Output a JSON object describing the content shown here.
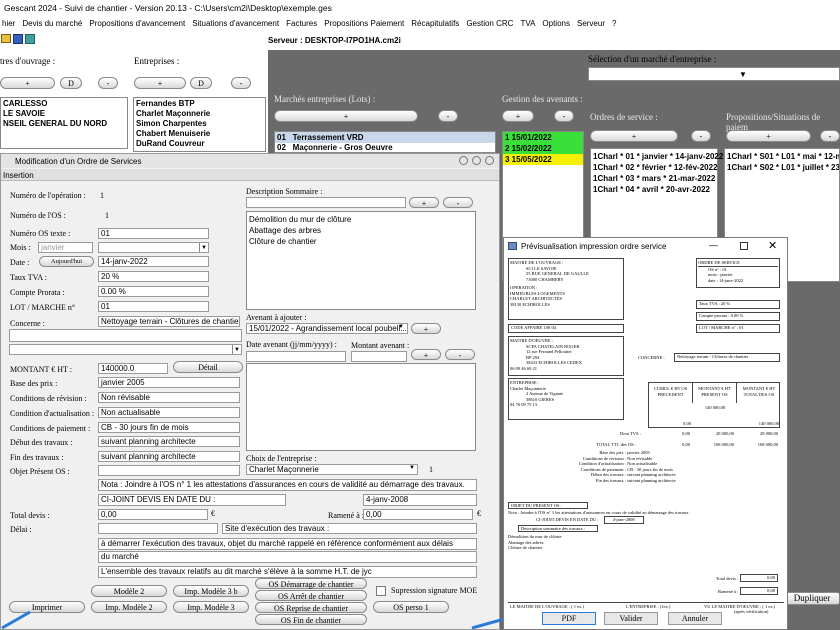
{
  "window": {
    "title": "Gescant 2024 - Suivi de chantier - Version 20.13 - C:\\Users\\cm2i\\Desktop\\exemple.ges"
  },
  "menu": [
    "hier",
    "Devis du marché",
    "Propositions d'avancement",
    "Situations d'avancement",
    "Factures",
    "Propositions Paiement",
    "Récapitulatifs",
    "Gestion CRC",
    "TVA",
    "Options",
    "Serveur",
    "?"
  ],
  "server": "Serveur : DESKTOP-I7PO1HA.cm2i",
  "top": {
    "maitres_label": "tres d'ouvrage :",
    "entreprises_label": "Entreprises :",
    "selection_label": "Sélection d'un marché d'entreprise :",
    "plus": "+",
    "d": "D",
    "minus": "-",
    "maitres": [
      "CARLESSO",
      " LE SAVOIE",
      "NSEIL GENERAL DU NORD"
    ],
    "entreprises": [
      "Fernandes BTP",
      "Charlet Maçonnerie",
      "Simon Charpentes",
      "Chabert Menuiserie",
      "DuRand Couvreur"
    ],
    "marches_label": "Marchés entreprises (Lots) :",
    "marches": [
      {
        "num": "01",
        "label": "Terrassement VRD"
      },
      {
        "num": "02",
        "label": "Maçonnerie - Gros Oeuvre"
      }
    ],
    "avenants_label": "Gestion des avenants :",
    "avenants": [
      {
        "text": "1 15/01/2022",
        "color": "#39e039"
      },
      {
        "text": "2 15/02/2022",
        "color": "#39e039"
      },
      {
        "text": "3 15/05/2022",
        "color": "#f5f000"
      }
    ],
    "os_label": "Ordres de service :",
    "os_items": [
      "1Charl * 01 * janvier * 14-janv-2022",
      "1Charl * 02 * février * 12-fév-2022",
      "1Charl * 03 * mars * 21-mar-2022",
      "1Charl * 04 * avril * 20-avr-2022"
    ],
    "props_label": "Propositions/Situations de paiem",
    "props_items": [
      "1Charl * S01 * L01 * mai * 12-ma",
      "1Charl * S02 * L01 * juillet * 23-ju"
    ],
    "dupliquer": "Dupliquer"
  },
  "modal": {
    "title": "Modification d'un Ordre de Services",
    "tab": "Insertion",
    "num_operation_label": "Numéro de l'opération :",
    "num_operation": "1",
    "num_os_label": "Numéro de l'OS :",
    "num_os": "1",
    "num_os_texte_label": "Numéro OS texte :",
    "num_os_texte": "01",
    "mois_label": "Mois :",
    "mois_placeholder": "janvier",
    "date_label": "Date :",
    "aujourdhui": "Aujourd'hui",
    "date": "14-janv-2022",
    "taux_tva_label": "Taux TVA :",
    "taux_tva": "20 %",
    "compte_prorata_label": "Compte Prorata :",
    "compte_prorata": "0.00 %",
    "lot_label": "LOT / MARCHE n°",
    "lot": "01",
    "concerne_label": "Concerne :",
    "concerne": "Nettoyage terrain - Clôtures de chantier",
    "description_label": "Description Sommaire :",
    "description_lines": [
      "Démolition du mur de clôture",
      "Abattage des arbres",
      "Clôture de chantier"
    ],
    "avenant_label": "Avenant à ajouter :",
    "avenant_value": "15/01/2022 - Agrandissement local poubell...",
    "date_avenant_label": "Date avenant (jj/mm/yyyy) :",
    "montant_avenant_label": "Montant avenant :",
    "montant_ht_label": "MONTANT € HT :",
    "montant_ht": "140000.0",
    "detail": "Détail",
    "base_prix_label": "Base des prix :",
    "base_prix": "janvier 2005",
    "revision_label": "Conditions de révision :",
    "revision": "Non révisable",
    "actualisation_label": "Condition d'actualisation :",
    "actualisation": "Non actualisable",
    "paiement_label": "Conditions de paiement :",
    "paiement": "CB - 30 jours fin de mois",
    "debut_label": "Début des travaux :",
    "debut": "suivant planning architecte",
    "fin_label": "Fin des travaux :",
    "fin": "suivant planning architecte",
    "objet_label": "Objet Présent OS :",
    "choix_label": "Choix de l'entreprise :",
    "choix": "Charlet Maçonnerie",
    "choix_num": "1",
    "note1": "Nota : Joindre à l'OS n° 1 les attestations d'assurances en cours de validité au démarrage des travaux.",
    "note2": "CI-JOINT DEVIS EN DATE DU :",
    "note2_date": "4-janv-2008",
    "total_devis_label": "Total devis :",
    "total_devis": "0,00",
    "euro": "€",
    "ramene_label": "Ramené à :",
    "ramene": "0,00",
    "delai_label": "Délai :",
    "site_label": "Site d'exécution des travaux :",
    "text_line1": "à démarrer l'exécution des travaux, objet du marché rappelé en référence conformément aux délais",
    "text_line2": "du marché",
    "text_line3": "L'ensemble des travaux relatifs au dit marché s'élève à la somme H.T. de jyc",
    "buttons": {
      "modele2": "Modèle 2",
      "imp_modele3b": "Imp. Modèle 3 b",
      "os_demarrage": "OS Démarrage de chantier",
      "imprimer": "Imprimer",
      "imp_modele2": "Imp. Modèle 2",
      "imp_modele3": "Imp. Modèle 3",
      "os_arret": "OS Arrêt de chantier",
      "os_reprise": "OS Reprise de chantier",
      "os_perso": "OS perso 1",
      "os_fin": "OS Fin de chantier"
    },
    "suppression_label": "Supression signature MOE",
    "plus": "+",
    "minus": "-"
  },
  "preview": {
    "title": "Prévisualisation impression ordre service",
    "pdf": "PDF",
    "valider": "Valider",
    "annuler": "Annuler",
    "maitre_ouvrage": [
      "MAITRE DE L'OUVRAGE :",
      "SCI LE SAVOIE",
      "55 RUE GENERAL DE GAULLE",
      "",
      "73000  CHAMBERY"
    ],
    "operation": [
      "OPERATION :",
      "IMMEUBLES LOGEMENTS",
      "CHARLET ARCHITECTES",
      "38130 ECHIROLLES"
    ],
    "ordre_service": "ORDRE DE SERVICE",
    "os_info": [
      "OS n° :       01",
      "mois :     janvier",
      "date :   14-janv-2022"
    ],
    "taux_tva": "Taux TVA :            20 %",
    "compte_prorata": "Compte prorata :          0.00 %",
    "lot_marche": "LOT / MARCHE n° :         01",
    "code_affaire": "CODE AFFAIRE          108 04",
    "maitre_oeuvre": [
      "MAITRE D'OEUVRE :",
      "SCPA CHATELAIN ROGER",
      "12 rue Fernand Pelloutier",
      "BP 294",
      "38433  ECHIROLLES CEDEX",
      "06 09 46 69 21"
    ],
    "concerne_lbl": "CONCERNE :",
    "concerne": "Nettoyage terrain - Clôtures de chantier",
    "entreprise": [
      "ENTREPRISE :",
      "Charlet Maçonnerie",
      "2 Avenue de Vignate",
      "",
      "38610  GIERES",
      "04 76 09 75 13"
    ],
    "table_heads": [
      "CUMUL € HT OS PRECEDENT",
      "MONTANT € HT PRESENT OS",
      "MONTANT € HT TOTAL DES OS"
    ],
    "row1": [
      "",
      "140 000,00",
      ""
    ],
    "row2": [
      "0,00",
      "",
      "140 000,00"
    ],
    "dont_tva_lbl": "Dont TVA :",
    "row3": [
      "0,00",
      "28 000,00",
      "28 000,00"
    ],
    "total_ttc_lbl": "TOTAL TTC des OS :",
    "row4": [
      "0,00",
      "168 000,00",
      "168 000,00"
    ],
    "conditions": [
      [
        "Base des prix :",
        "janvier 2005"
      ],
      [
        "Conditions de révision :",
        "Non révisable"
      ],
      [
        "Condition d'actualisation :",
        "Non actualisable"
      ],
      [
        "Conditions de paiement :",
        "CB - 30 jours fin de mois"
      ],
      [
        "Début des travaux :",
        "suivant planning architecte"
      ],
      [
        "Fin des travaux :",
        "suivant planning architecte"
      ]
    ],
    "objet": "OBJET DU PRESENT OS :",
    "nota": "Nota : Joindre à l'OS n° 1 les attestations d'assurances en cours de validité au démarrage des travaux.",
    "ci_joint": "CI-JOINT DEVIS EN DATE DU :",
    "ci_joint_date": "4-janv-2008",
    "desc_sommaire": "Description sommaire des travaux :",
    "desc_lines": [
      "Démolition du mur de clôture",
      "Abattage des arbres",
      "Clôture de chantier"
    ],
    "total_devis_lbl": "Total devis :",
    "total_devis": "0,00",
    "ramene_lbl": "Ramené à :",
    "ramene": "0,00",
    "sign_moa": "LE MAITRE DE L'OUVRAGE : ( 1 ex.)",
    "sign_ent": "L'ENTREPRISE :   (1ex.)",
    "sign_moe": "VU LE MAITRE D'OEUVRE :  ( 1 ex.)",
    "sign_moe2": "(après vérification)"
  }
}
